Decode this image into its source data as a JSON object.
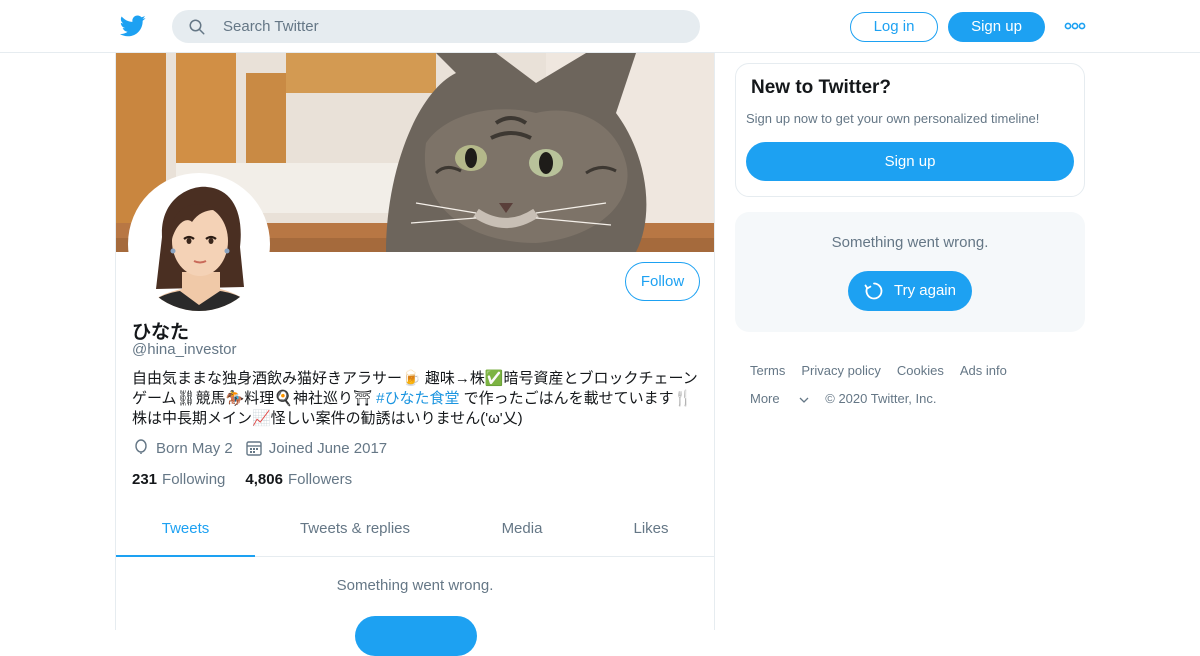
{
  "topbar": {
    "logo_icon": "twitter-bird-icon",
    "search_placeholder": "Search Twitter",
    "login_label": "Log in",
    "signup_label": "Sign up",
    "more_icon": "more-dots-icon"
  },
  "profile": {
    "display_name": "ひなた",
    "handle": "@hina_investor",
    "follow_label": "Follow",
    "bio_parts": {
      "part1": "自由気ままな独身酒飲み猫好きアラサー🍺 趣味→株✅暗号資産とブロックチェーンゲーム⛓競馬🏇料理🍳神社巡り⛩ ",
      "hashtag": "#ひなた食堂",
      "part2": " で作ったごはんを載せています🍴株は中長期メイン📈怪しい案件の勧誘はいりません('ω'乂)"
    },
    "birthday": "Born May 2",
    "joined": "Joined June 2017",
    "following_count": "231",
    "following_label": "Following",
    "followers_count": "4,806",
    "followers_label": "Followers"
  },
  "tabs": [
    {
      "label": "Tweets",
      "active": true
    },
    {
      "label": "Tweets & replies",
      "active": false
    },
    {
      "label": "Media",
      "active": false
    },
    {
      "label": "Likes",
      "active": false
    }
  ],
  "timeline": {
    "error_message": "Something went wrong."
  },
  "sidebar": {
    "new_title": "New to Twitter?",
    "new_sub": "Sign up now to get your own personalized timeline!",
    "new_signup": "Sign up",
    "error_message": "Something went wrong.",
    "try_again": "Try again",
    "footer_links_row1": [
      "Terms",
      "Privacy policy",
      "Cookies",
      "Ads info"
    ],
    "footer_more": "More",
    "copyright": "© 2020 Twitter, Inc."
  },
  "colors": {
    "accent": "#1da1f2",
    "text_secondary": "#657786",
    "hashtag": "#1b95e0"
  }
}
